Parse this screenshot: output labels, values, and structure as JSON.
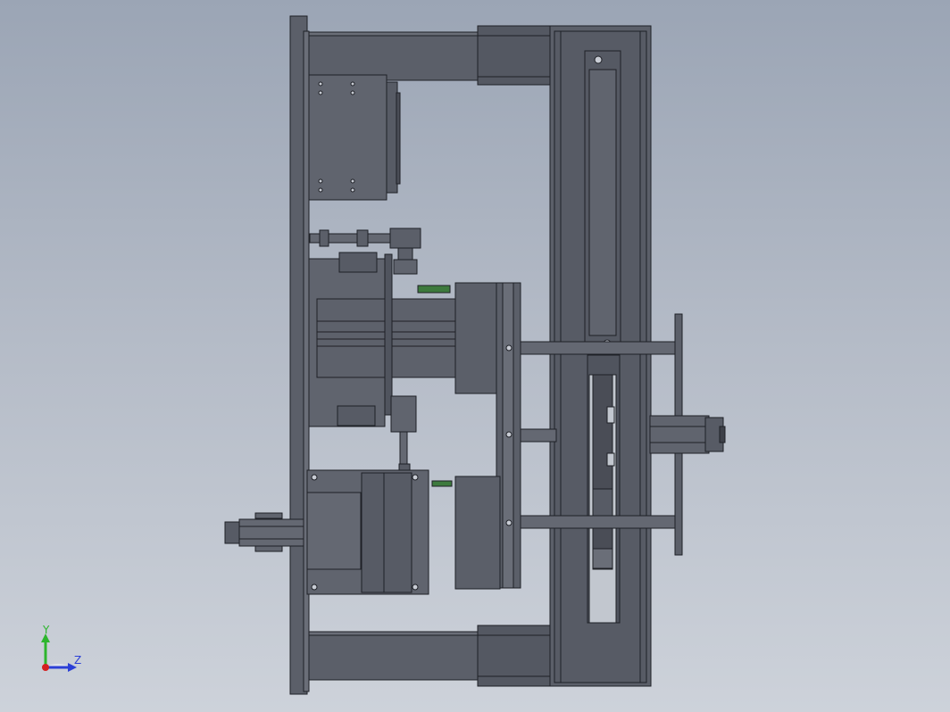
{
  "view": {
    "background_top": "#9ba5b5",
    "background_bottom": "#cdd2da",
    "part_fill": "#5b5f69",
    "part_light": "#6a6e78",
    "part_dark": "#4a4d56",
    "edge_color": "#1e2026",
    "accent_green": "#3d7a3d"
  },
  "triad": {
    "y_label": "Y",
    "z_label": "Z",
    "y_color": "#2db52d",
    "z_color": "#2b3fd6",
    "x_color": "#d42020"
  }
}
